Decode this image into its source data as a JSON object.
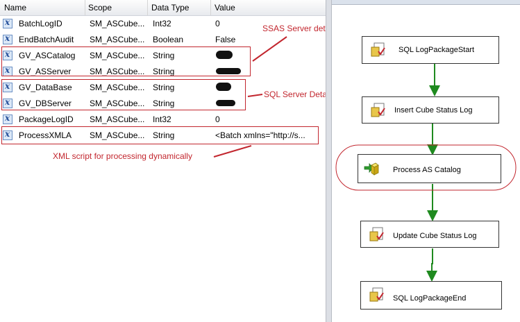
{
  "variables_grid": {
    "columns": [
      "Name",
      "Scope",
      "Data Type",
      "Value"
    ],
    "rows": [
      {
        "name": "BatchLogID",
        "scope": "SM_ASCube...",
        "type": "Int32",
        "value": "0"
      },
      {
        "name": "EndBatchAudit",
        "scope": "SM_ASCube...",
        "type": "Boolean",
        "value": "False"
      },
      {
        "name": "GV_ASCatalog",
        "scope": "SM_ASCube...",
        "type": "String",
        "value": ""
      },
      {
        "name": "GV_ASServer",
        "scope": "SM_ASCube...",
        "type": "String",
        "value": ""
      },
      {
        "name": "GV_DataBase",
        "scope": "SM_ASCube...",
        "type": "String",
        "value": ""
      },
      {
        "name": "GV_DBServer",
        "scope": "SM_ASCube...",
        "type": "String",
        "value": ""
      },
      {
        "name": "PackageLogID",
        "scope": "SM_ASCube...",
        "type": "Int32",
        "value": "0"
      },
      {
        "name": "ProcessXMLA",
        "scope": "SM_ASCube...",
        "type": "String",
        "value": "<Batch xmlns=\"http://s..."
      }
    ]
  },
  "annotations": {
    "ssas": "SSAS Server details",
    "sql": "SQL Server Details",
    "xml": "XML script for processing dynamically"
  },
  "control_flow": {
    "tasks": [
      {
        "label": "SQL LogPackageStart",
        "icon": "sql-task-icon"
      },
      {
        "label": "Insert Cube Status Log",
        "icon": "sql-task-icon"
      },
      {
        "label": "Process AS Catalog",
        "icon": "analysis-services-processing-icon"
      },
      {
        "label": "Update Cube Status Log",
        "icon": "sql-task-icon"
      },
      {
        "label": "SQL LogPackageEnd",
        "icon": "sql-task-icon"
      }
    ]
  },
  "colors": {
    "annotation_red": "#c2262e",
    "precedence_green": "#1f8a1f",
    "variable_icon_blue": "#254f9a"
  }
}
